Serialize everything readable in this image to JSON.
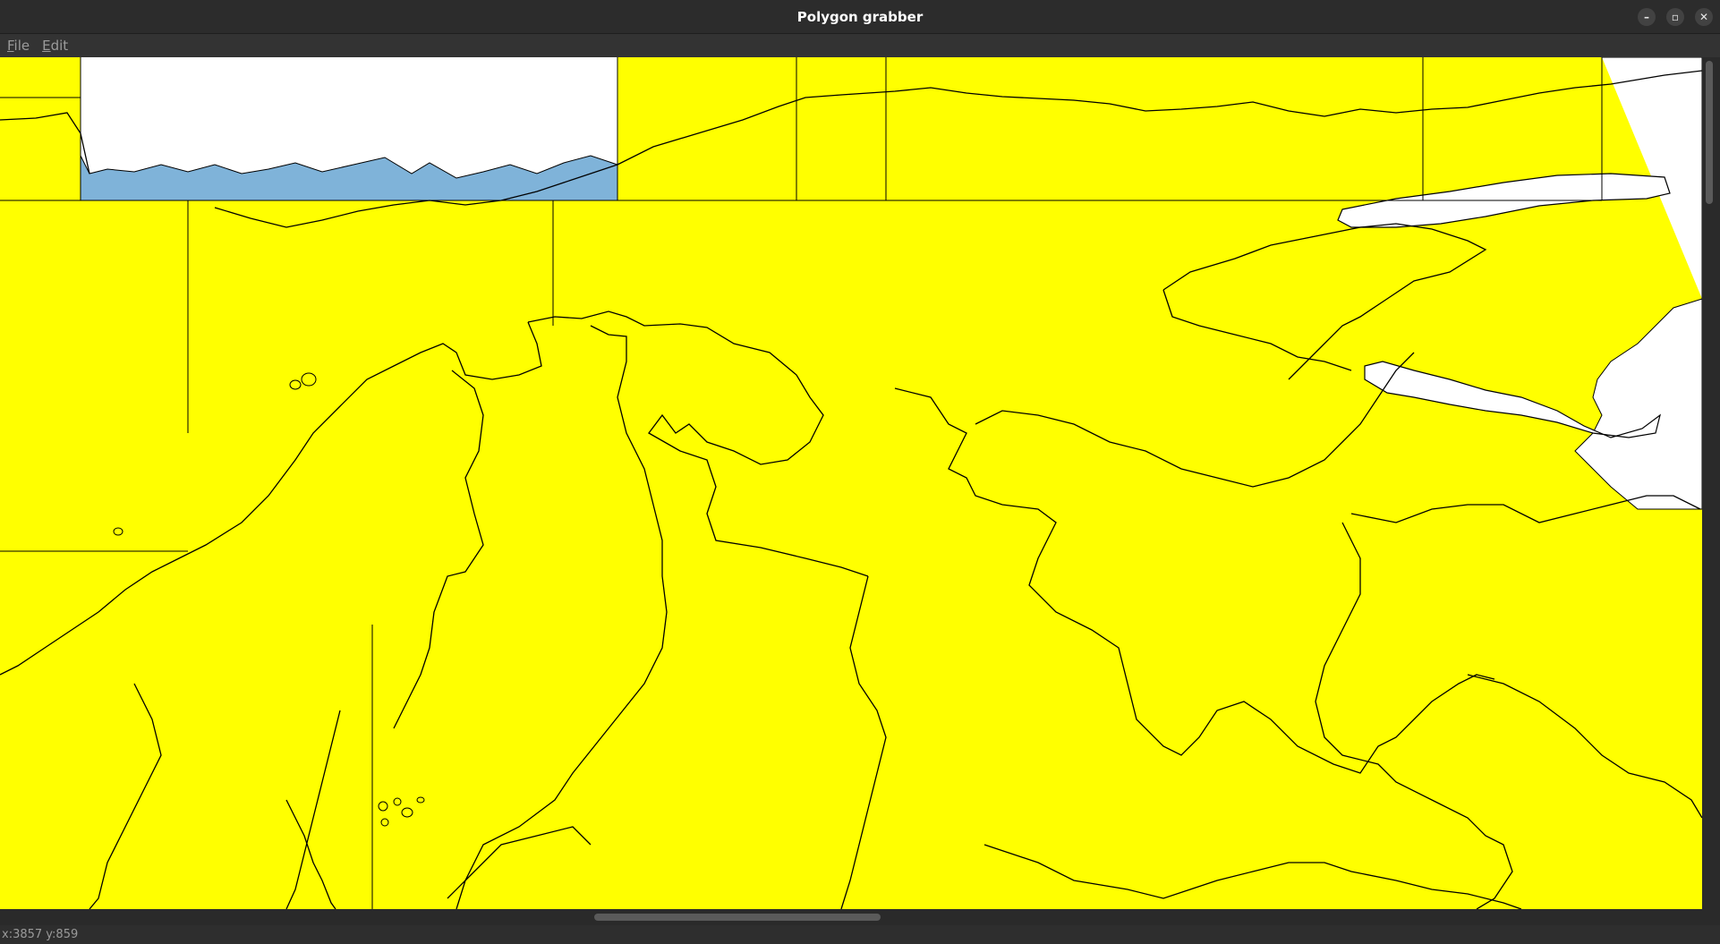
{
  "window": {
    "title": "Polygon grabber",
    "controls": {
      "minimize": "–",
      "restore": "▫",
      "close": "✕"
    }
  },
  "menu": {
    "file": {
      "mnemonic": "F",
      "rest": "ile"
    },
    "edit": {
      "mnemonic": "E",
      "rest": "dit"
    }
  },
  "map": {
    "land_color": "#ffff00",
    "water_color": "#7fb3d9",
    "nodata_color": "#ffffff",
    "outline_color": "#000000"
  },
  "status": {
    "cursor_readout": "x:3857 y:859"
  }
}
